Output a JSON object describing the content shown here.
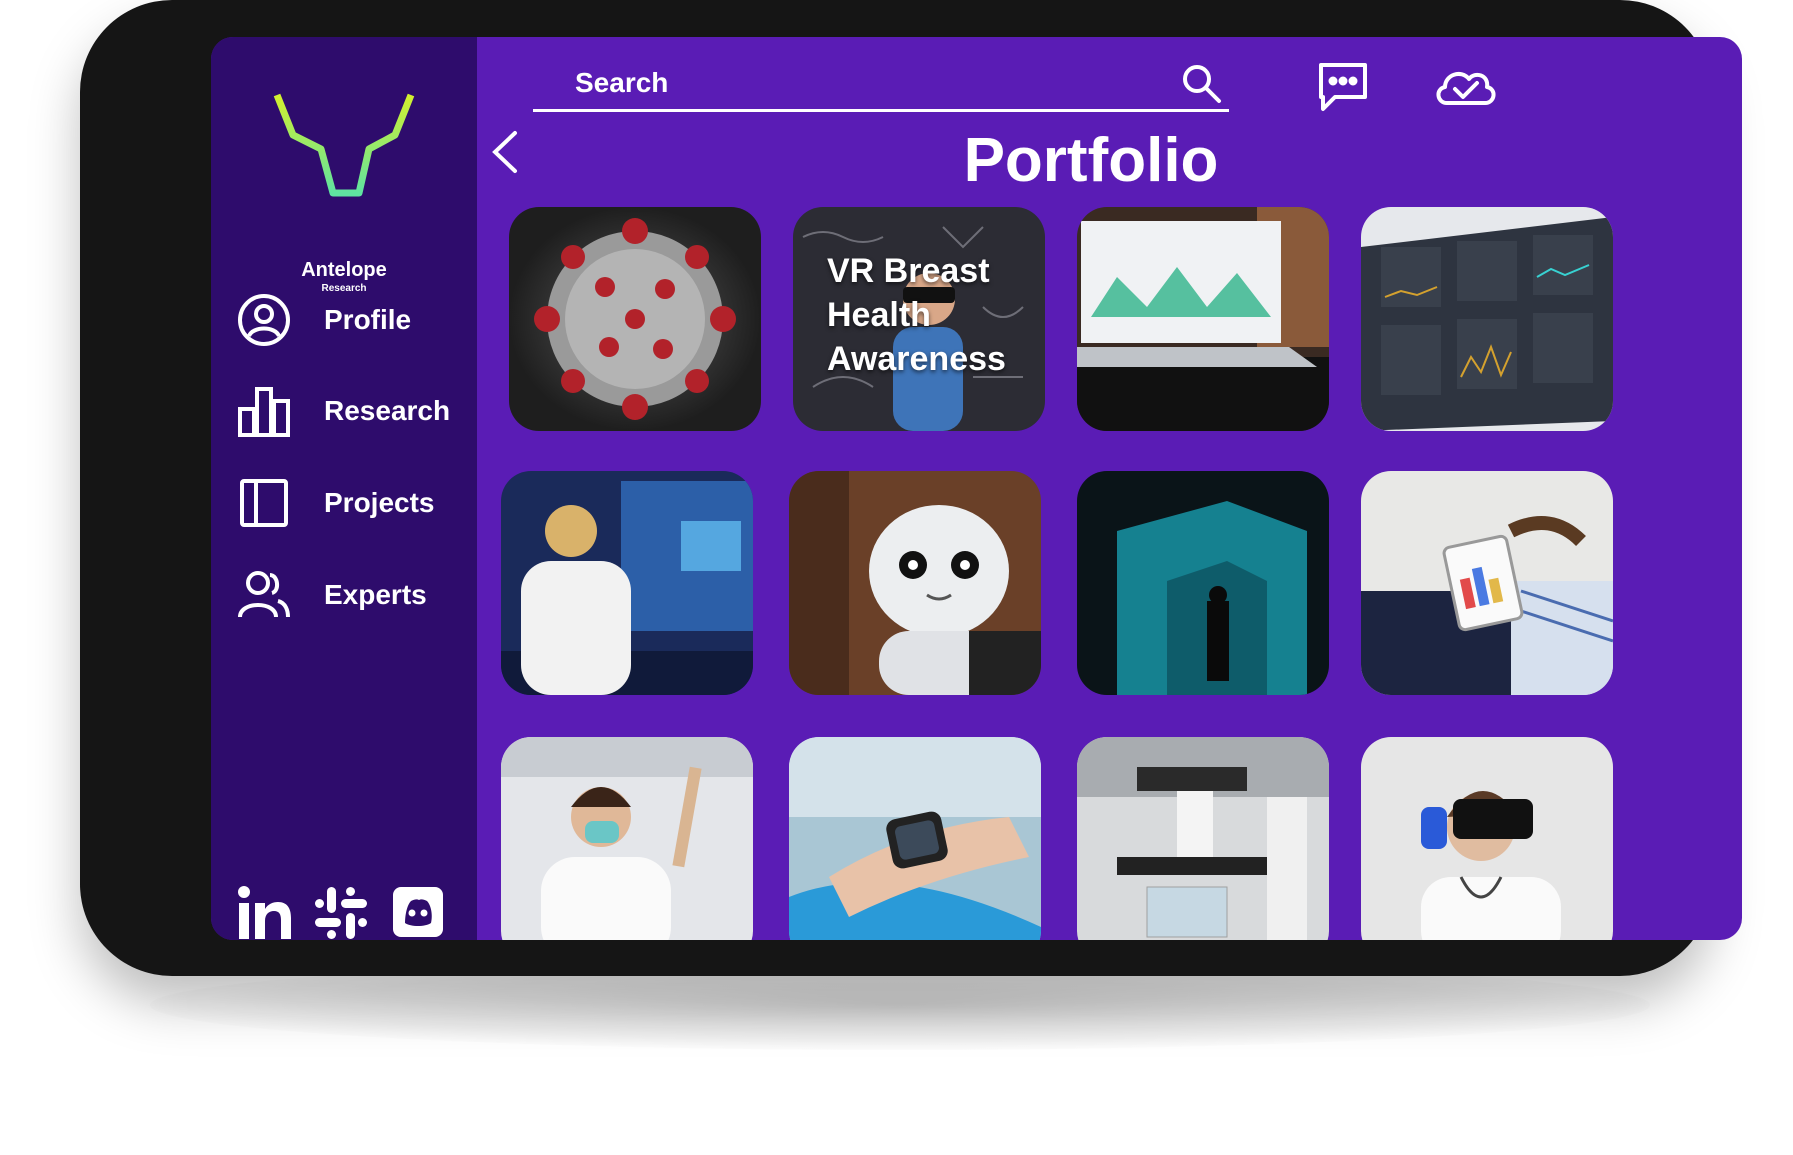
{
  "brand": {
    "name": "Antelope",
    "tagline": "Research"
  },
  "colors": {
    "sidebar": "#2e0c6c",
    "main": "#5a1cb5",
    "logo_yellow": "#d4f02e",
    "logo_green": "#5fe3a1",
    "text": "#ffffff"
  },
  "sidebar": {
    "items": [
      {
        "label": "Profile",
        "icon": "user-circle-icon"
      },
      {
        "label": "Research",
        "icon": "bar-chart-icon"
      },
      {
        "label": "Projects",
        "icon": "panel-icon"
      },
      {
        "label": "Experts",
        "icon": "users-icon"
      }
    ],
    "social": [
      "linkedin-icon",
      "slack-icon",
      "discord-icon"
    ]
  },
  "search": {
    "placeholder": "Search",
    "value": ""
  },
  "topbar": {
    "icons": [
      "search-icon",
      "chat-icon",
      "cloud-check-icon"
    ]
  },
  "page": {
    "title": "Portfolio"
  },
  "portfolio": {
    "cards": [
      {
        "subject": "coronavirus-3d",
        "title": ""
      },
      {
        "subject": "vr-classroom",
        "title": "VR Breast Health Awareness"
      },
      {
        "subject": "laptop-dashboard",
        "title": ""
      },
      {
        "subject": "analytics-screen",
        "title": ""
      },
      {
        "subject": "lab-scientist",
        "title": ""
      },
      {
        "subject": "humanoid-robot",
        "title": ""
      },
      {
        "subject": "light-installation",
        "title": ""
      },
      {
        "subject": "tablet-charts",
        "title": ""
      },
      {
        "subject": "lab-researcher-mask",
        "title": ""
      },
      {
        "subject": "smartwatch",
        "title": ""
      },
      {
        "subject": "microscope",
        "title": ""
      },
      {
        "subject": "doctor-vr-headset",
        "title": ""
      }
    ]
  }
}
